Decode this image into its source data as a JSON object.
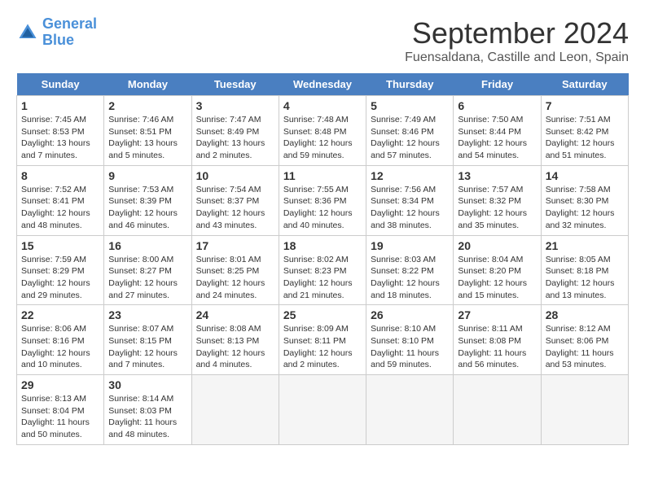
{
  "logo": {
    "line1": "General",
    "line2": "Blue"
  },
  "title": "September 2024",
  "subtitle": "Fuensaldana, Castille and Leon, Spain",
  "days_of_week": [
    "Sunday",
    "Monday",
    "Tuesday",
    "Wednesday",
    "Thursday",
    "Friday",
    "Saturday"
  ],
  "weeks": [
    [
      {
        "day": "1",
        "info": "Sunrise: 7:45 AM\nSunset: 8:53 PM\nDaylight: 13 hours\nand 7 minutes."
      },
      {
        "day": "2",
        "info": "Sunrise: 7:46 AM\nSunset: 8:51 PM\nDaylight: 13 hours\nand 5 minutes."
      },
      {
        "day": "3",
        "info": "Sunrise: 7:47 AM\nSunset: 8:49 PM\nDaylight: 13 hours\nand 2 minutes."
      },
      {
        "day": "4",
        "info": "Sunrise: 7:48 AM\nSunset: 8:48 PM\nDaylight: 12 hours\nand 59 minutes."
      },
      {
        "day": "5",
        "info": "Sunrise: 7:49 AM\nSunset: 8:46 PM\nDaylight: 12 hours\nand 57 minutes."
      },
      {
        "day": "6",
        "info": "Sunrise: 7:50 AM\nSunset: 8:44 PM\nDaylight: 12 hours\nand 54 minutes."
      },
      {
        "day": "7",
        "info": "Sunrise: 7:51 AM\nSunset: 8:42 PM\nDaylight: 12 hours\nand 51 minutes."
      }
    ],
    [
      {
        "day": "8",
        "info": "Sunrise: 7:52 AM\nSunset: 8:41 PM\nDaylight: 12 hours\nand 48 minutes."
      },
      {
        "day": "9",
        "info": "Sunrise: 7:53 AM\nSunset: 8:39 PM\nDaylight: 12 hours\nand 46 minutes."
      },
      {
        "day": "10",
        "info": "Sunrise: 7:54 AM\nSunset: 8:37 PM\nDaylight: 12 hours\nand 43 minutes."
      },
      {
        "day": "11",
        "info": "Sunrise: 7:55 AM\nSunset: 8:36 PM\nDaylight: 12 hours\nand 40 minutes."
      },
      {
        "day": "12",
        "info": "Sunrise: 7:56 AM\nSunset: 8:34 PM\nDaylight: 12 hours\nand 38 minutes."
      },
      {
        "day": "13",
        "info": "Sunrise: 7:57 AM\nSunset: 8:32 PM\nDaylight: 12 hours\nand 35 minutes."
      },
      {
        "day": "14",
        "info": "Sunrise: 7:58 AM\nSunset: 8:30 PM\nDaylight: 12 hours\nand 32 minutes."
      }
    ],
    [
      {
        "day": "15",
        "info": "Sunrise: 7:59 AM\nSunset: 8:29 PM\nDaylight: 12 hours\nand 29 minutes."
      },
      {
        "day": "16",
        "info": "Sunrise: 8:00 AM\nSunset: 8:27 PM\nDaylight: 12 hours\nand 27 minutes."
      },
      {
        "day": "17",
        "info": "Sunrise: 8:01 AM\nSunset: 8:25 PM\nDaylight: 12 hours\nand 24 minutes."
      },
      {
        "day": "18",
        "info": "Sunrise: 8:02 AM\nSunset: 8:23 PM\nDaylight: 12 hours\nand 21 minutes."
      },
      {
        "day": "19",
        "info": "Sunrise: 8:03 AM\nSunset: 8:22 PM\nDaylight: 12 hours\nand 18 minutes."
      },
      {
        "day": "20",
        "info": "Sunrise: 8:04 AM\nSunset: 8:20 PM\nDaylight: 12 hours\nand 15 minutes."
      },
      {
        "day": "21",
        "info": "Sunrise: 8:05 AM\nSunset: 8:18 PM\nDaylight: 12 hours\nand 13 minutes."
      }
    ],
    [
      {
        "day": "22",
        "info": "Sunrise: 8:06 AM\nSunset: 8:16 PM\nDaylight: 12 hours\nand 10 minutes."
      },
      {
        "day": "23",
        "info": "Sunrise: 8:07 AM\nSunset: 8:15 PM\nDaylight: 12 hours\nand 7 minutes."
      },
      {
        "day": "24",
        "info": "Sunrise: 8:08 AM\nSunset: 8:13 PM\nDaylight: 12 hours\nand 4 minutes."
      },
      {
        "day": "25",
        "info": "Sunrise: 8:09 AM\nSunset: 8:11 PM\nDaylight: 12 hours\nand 2 minutes."
      },
      {
        "day": "26",
        "info": "Sunrise: 8:10 AM\nSunset: 8:10 PM\nDaylight: 11 hours\nand 59 minutes."
      },
      {
        "day": "27",
        "info": "Sunrise: 8:11 AM\nSunset: 8:08 PM\nDaylight: 11 hours\nand 56 minutes."
      },
      {
        "day": "28",
        "info": "Sunrise: 8:12 AM\nSunset: 8:06 PM\nDaylight: 11 hours\nand 53 minutes."
      }
    ],
    [
      {
        "day": "29",
        "info": "Sunrise: 8:13 AM\nSunset: 8:04 PM\nDaylight: 11 hours\nand 50 minutes."
      },
      {
        "day": "30",
        "info": "Sunrise: 8:14 AM\nSunset: 8:03 PM\nDaylight: 11 hours\nand 48 minutes."
      },
      {
        "day": "",
        "info": ""
      },
      {
        "day": "",
        "info": ""
      },
      {
        "day": "",
        "info": ""
      },
      {
        "day": "",
        "info": ""
      },
      {
        "day": "",
        "info": ""
      }
    ]
  ]
}
